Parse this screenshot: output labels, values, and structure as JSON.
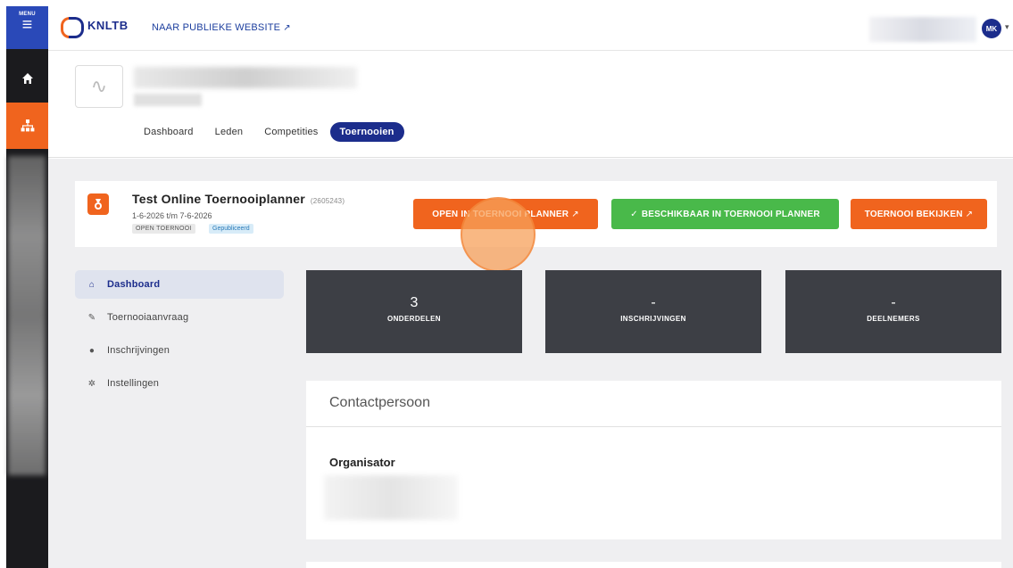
{
  "rail": {
    "menu_label": "MENU",
    "menu_icon": "hamburger-icon",
    "home_icon": "home-icon",
    "org_icon": "org-chart-icon"
  },
  "topbar": {
    "logo_text": "KNLTB",
    "public_site_label": "NAAR PUBLIEKE WEBSITE",
    "avatar_initials": "MK"
  },
  "org": {
    "tabs": [
      {
        "label": "Dashboard"
      },
      {
        "label": "Leden"
      },
      {
        "label": "Competities"
      },
      {
        "label": "Toernooien"
      }
    ],
    "active_tab": "Toernooien"
  },
  "tournament": {
    "title": "Test Online Toernooiplanner",
    "id": "(2605243)",
    "dates": "1-6-2026 t/m 7-6-2026",
    "badge_open": "OPEN TOERNOOI",
    "badge_published": "Gepubliceerd",
    "btn_open_planner": "OPEN IN TOERNOOI PLANNER",
    "btn_available": "BESCHIKBAAR IN TOERNOOI PLANNER",
    "btn_view": "TOERNOOI BEKIJKEN",
    "check_glyph": "✓"
  },
  "sidenav": [
    {
      "label": "Dashboard",
      "icon": "home-icon",
      "glyph": "⌂"
    },
    {
      "label": "Toernooiaanvraag",
      "icon": "pencil-icon",
      "glyph": "✎"
    },
    {
      "label": "Inschrijvingen",
      "icon": "user-icon",
      "glyph": "●"
    },
    {
      "label": "Instellingen",
      "icon": "gear-icon",
      "glyph": "✲"
    }
  ],
  "stats": [
    {
      "value": "3",
      "label": "ONDERDELEN"
    },
    {
      "value": "-",
      "label": "INSCHRIJVINGEN"
    },
    {
      "value": "-",
      "label": "DEELNEMERS"
    }
  ],
  "contact": {
    "heading": "Contactpersoon",
    "role_label": "Organisator"
  },
  "colors": {
    "brand_blue": "#1c2d8c",
    "brand_orange": "#f0641e",
    "success_green": "#49b94a",
    "tile_dark": "#3d3f45"
  }
}
